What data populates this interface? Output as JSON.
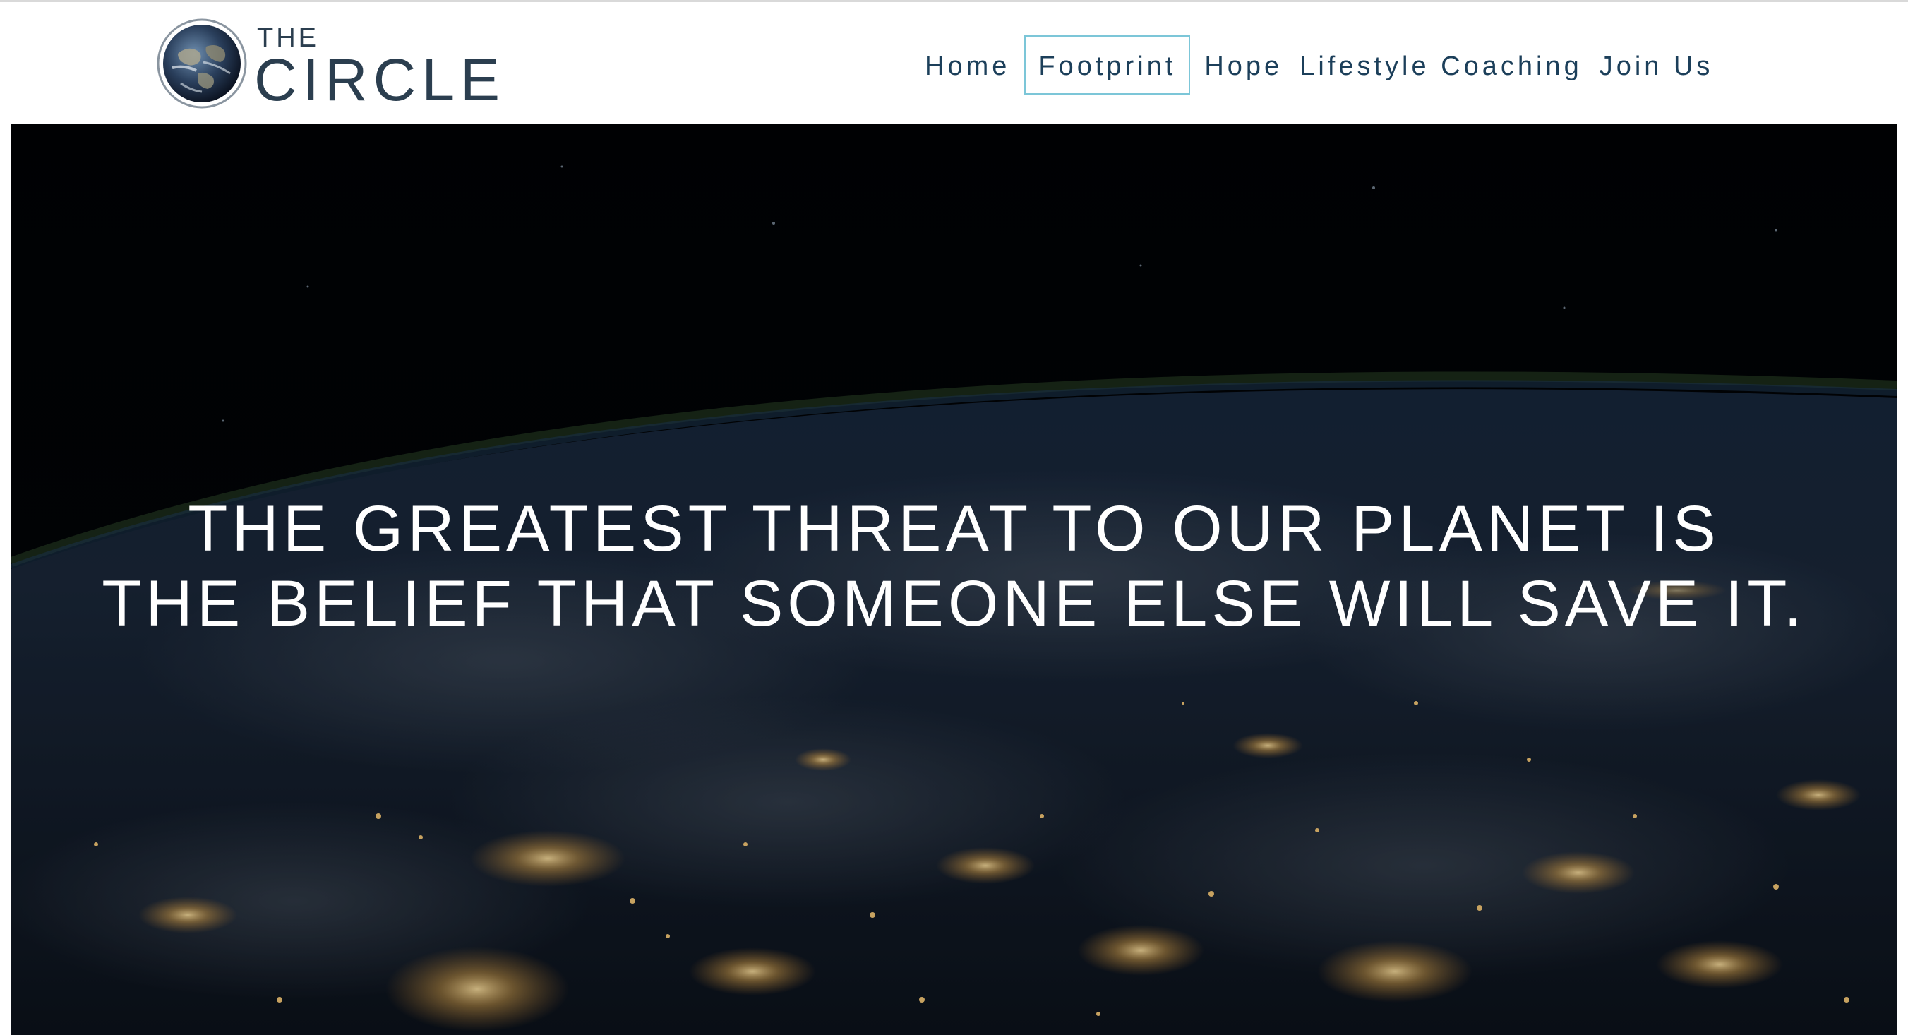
{
  "brand": {
    "logo_top": "THE",
    "logo_bottom": "CIRCLE",
    "logo_icon": "earth-globe-icon",
    "text_color": "#2b3e4f"
  },
  "nav": {
    "items": [
      {
        "label": "Home",
        "active": false
      },
      {
        "label": "Footprint",
        "active": true
      },
      {
        "label": "Hope",
        "active": false
      },
      {
        "label": "Lifestyle Coaching",
        "active": false
      },
      {
        "label": "Join Us",
        "active": false
      }
    ],
    "text_color": "#1c3f5a",
    "active_border_color": "#7cc6d8"
  },
  "hero": {
    "background": "earth-at-night-from-space",
    "quote_line_1": "THE GREATEST THREAT TO OUR PLANET IS",
    "quote_line_2": "THE BELIEF THAT SOMEONE ELSE WILL SAVE IT."
  }
}
